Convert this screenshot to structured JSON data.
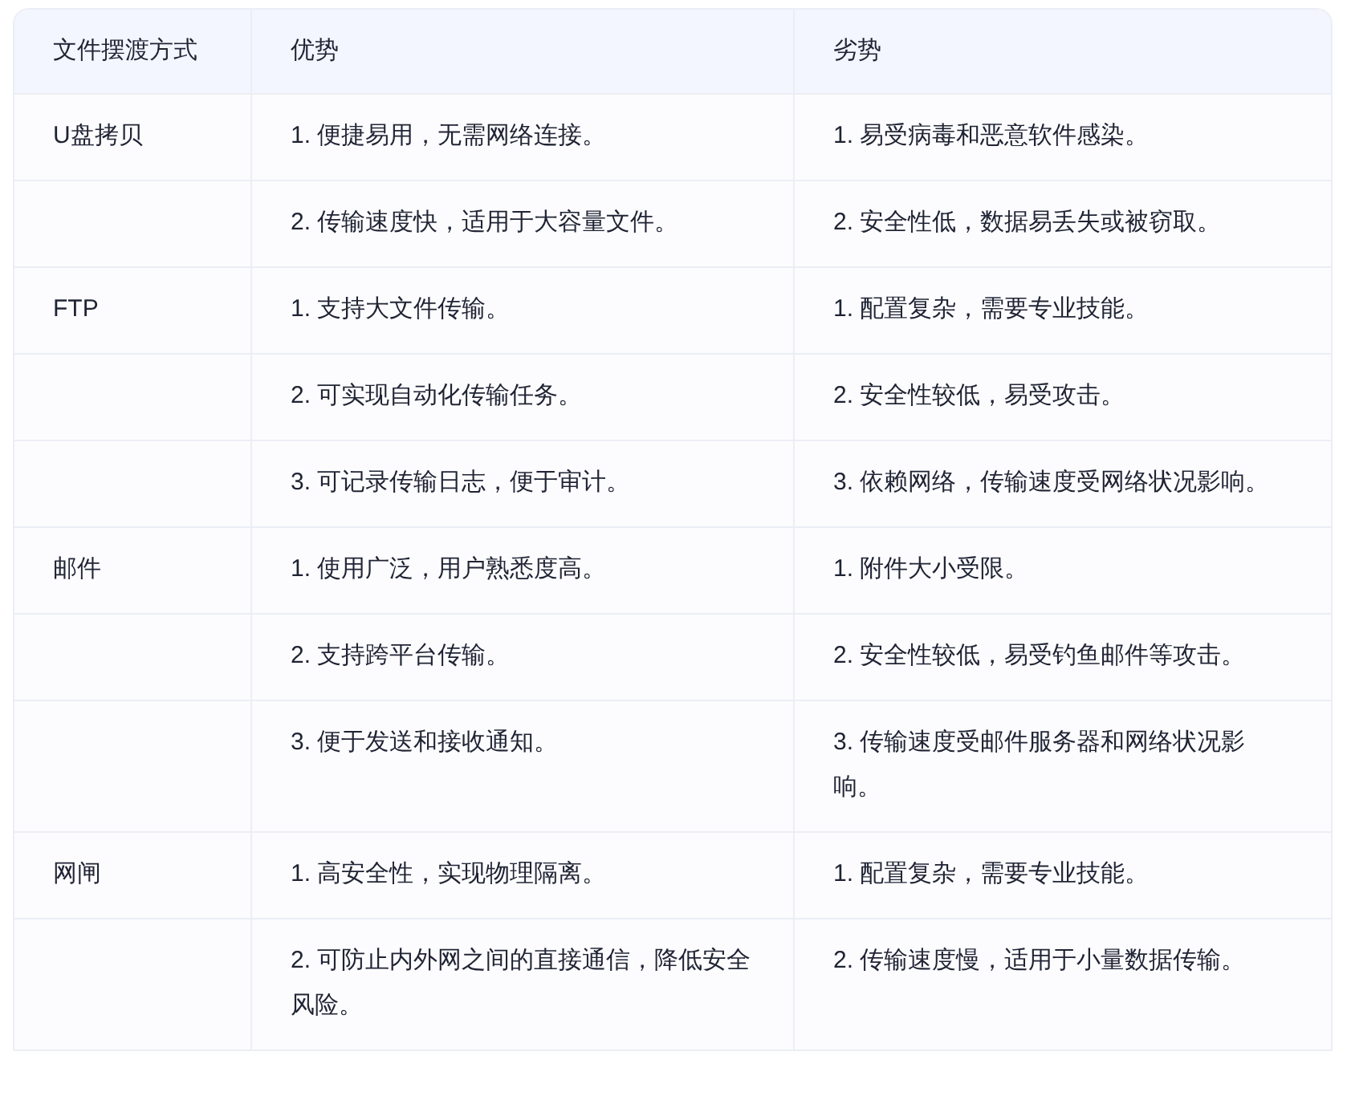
{
  "table": {
    "columns": [
      "文件摆渡方式",
      "优势",
      "劣势"
    ],
    "rows": [
      {
        "method": "U盘拷贝",
        "advantage": "1. 便捷易用，无需网络连接。",
        "disadvantage": "1. 易受病毒和恶意软件感染。"
      },
      {
        "advantage": "2. 传输速度快，适用于大容量文件。",
        "disadvantage": "2. 安全性低，数据易丢失或被窃取。"
      },
      {
        "method": "FTP",
        "advantage": "1. 支持大文件传输。",
        "disadvantage": "1. 配置复杂，需要专业技能。"
      },
      {
        "advantage": "2. 可实现自动化传输任务。",
        "disadvantage": "2. 安全性较低，易受攻击。"
      },
      {
        "advantage": "3. 可记录传输日志，便于审计。",
        "disadvantage": "3. 依赖网络，传输速度受网络状况影响。"
      },
      {
        "method": "邮件",
        "advantage": "1. 使用广泛，用户熟悉度高。",
        "disadvantage": "1. 附件大小受限。"
      },
      {
        "advantage": "2. 支持跨平台传输。",
        "disadvantage": "2. 安全性较低，易受钓鱼邮件等攻击。"
      },
      {
        "advantage": "3. 便于发送和接收通知。",
        "disadvantage": "3. 传输速度受邮件服务器和网络状况影响。"
      },
      {
        "method": "网闸",
        "advantage": "1. 高安全性，实现物理隔离。",
        "disadvantage": "1. 配置复杂，需要专业技能。"
      },
      {
        "advantage": "2. 可防止内外网之间的直接通信，降低安全风险。",
        "disadvantage": "2. 传输速度慢，适用于小量数据传输。"
      }
    ]
  }
}
